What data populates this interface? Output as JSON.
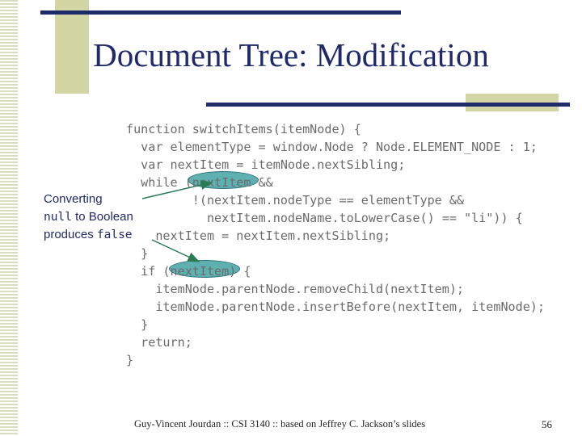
{
  "slide": {
    "title": "Document Tree: Modification",
    "code_lines": [
      "function switchItems(itemNode) {",
      "  var elementType = window.Node ? Node.ELEMENT_NODE : 1;",
      "  var nextItem = itemNode.nextSibling;",
      "  while (nextItem &&",
      "         !(nextItem.nodeType == elementType &&",
      "           nextItem.nodeName.toLowerCase() == \"li\")) {",
      "    nextItem = nextItem.nextSibling;",
      "  }",
      "  if (nextItem) {",
      "    itemNode.parentNode.removeChild(nextItem);",
      "    itemNode.parentNode.insertBefore(nextItem, itemNode);",
      "  }",
      "  return;",
      "}"
    ],
    "annotation": {
      "line1": "Converting",
      "null_word": "null",
      "to_boolean": " to Boolean",
      "produces": "produces ",
      "false_word": "false"
    },
    "footer": "Guy-Vincent Jourdan :: CSI 3140 :: based on Jeffrey C. Jackson’s slides",
    "page_number": "56",
    "colors": {
      "title": "#1e2a6a",
      "code": "#6b6b6b",
      "highlight": "#5fb0b0",
      "arrow": "#2a7a55",
      "accent_bar": "#1e2a6a",
      "accent_block": "#d4d5a4"
    }
  }
}
